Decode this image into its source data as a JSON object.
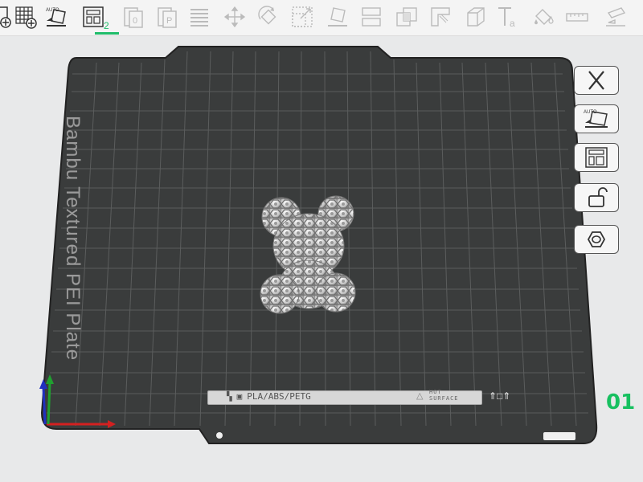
{
  "toolbar": {
    "buttons": [
      {
        "id": "add-plate",
        "icon": "add-plate-icon"
      },
      {
        "id": "add-object",
        "icon": "grid-add-icon"
      },
      {
        "id": "auto-orient",
        "icon": "auto-orient-icon",
        "badge": "AUTO"
      },
      {
        "id": "arrange",
        "icon": "arrange-icon"
      },
      {
        "id": "copy",
        "icon": "copy-icon"
      },
      {
        "id": "paste",
        "icon": "paste-icon"
      },
      {
        "id": "layers",
        "icon": "layers-icon"
      },
      {
        "id": "move",
        "icon": "move-icon"
      },
      {
        "id": "rotate",
        "icon": "rotate-icon"
      },
      {
        "id": "scale",
        "icon": "scale-icon"
      },
      {
        "id": "lay-on-face",
        "icon": "lay-on-face-icon"
      },
      {
        "id": "cut",
        "icon": "cut-icon"
      },
      {
        "id": "boolean",
        "icon": "boolean-icon"
      },
      {
        "id": "support-paint",
        "icon": "support-paint-icon"
      },
      {
        "id": "seam-paint",
        "icon": "seam-paint-icon"
      },
      {
        "id": "text",
        "icon": "text-icon"
      },
      {
        "id": "color-paint",
        "icon": "color-paint-icon"
      },
      {
        "id": "measure",
        "icon": "measure-icon"
      },
      {
        "id": "assembly",
        "icon": "assembly-icon"
      }
    ],
    "arrange_sub": "2"
  },
  "plate": {
    "label": "Bambu Textured PEI Plate",
    "index": "01",
    "info_filament": "PLA/ABS/PETG",
    "hot_surface_line1": "HOT",
    "hot_surface_line2": "SURFACE"
  },
  "side_buttons": [
    {
      "id": "close-plate",
      "icon": "close-icon"
    },
    {
      "id": "auto-orient-plate",
      "icon": "auto-orient-icon",
      "badge": "AUTO"
    },
    {
      "id": "arrange-plate",
      "icon": "arrange-icon"
    },
    {
      "id": "lock-plate",
      "icon": "unlock-icon"
    },
    {
      "id": "plate-settings",
      "icon": "hex-nut-icon"
    }
  ],
  "colors": {
    "plate": "#3a3c3c",
    "grid": "#5b5d5d",
    "accent": "#17c060",
    "axis_x": "#d42020",
    "axis_y": "#20a030",
    "axis_z": "#2030c0"
  }
}
